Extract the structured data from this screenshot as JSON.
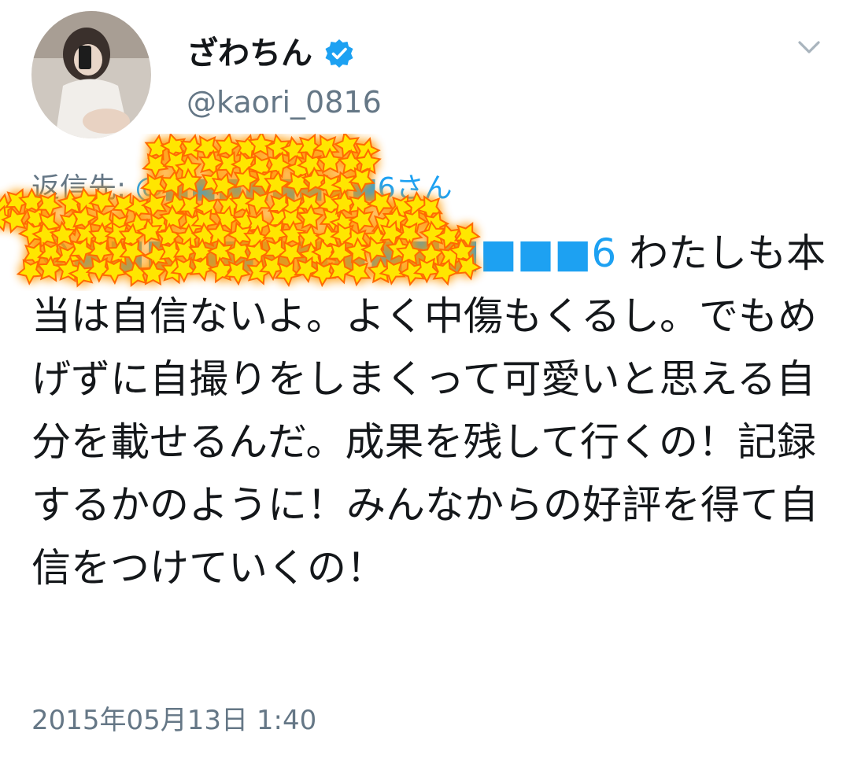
{
  "user": {
    "display_name": "ざわちん",
    "handle": "@kaori_0816",
    "verified": true,
    "verified_icon": "verified-badge-icon"
  },
  "reply": {
    "prefix": "返信先: ",
    "mention": "@■■■■■■■■6さん"
  },
  "tweet": {
    "mention": "@■■■■■■■■■■■■■■6 ",
    "text": "わたしも本当は自信ないよ。よく中傷もくるし。でもめげずに自撮りをしまくって可愛いと思える自分を載せるんだ。成果を残して行くの！記録するかのように！みんなからの好評を得て自信をつけていくの！",
    "timestamp": "2015年05月13日 1:40"
  },
  "colors": {
    "link": "#1da1f2",
    "secondary": "#657786",
    "text": "#14171a",
    "censor_fill": "#ffe600",
    "censor_glow": "#ff6a00"
  },
  "icons": {
    "caret": "chevron-down-icon"
  }
}
